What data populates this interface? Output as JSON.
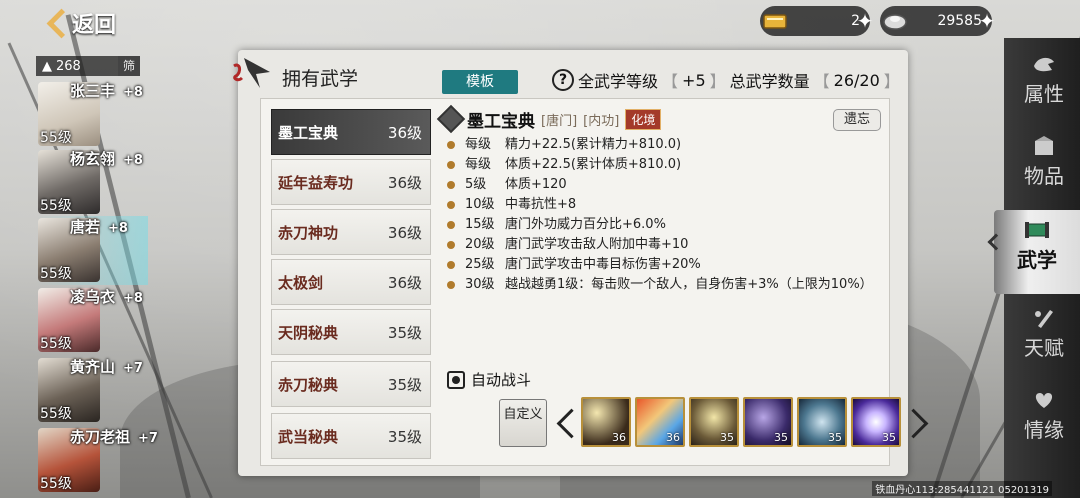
{
  "header": {
    "back_label": "返回",
    "currency_gold": "2",
    "currency_silver": "29585"
  },
  "hero_filter": {
    "power": "268",
    "filter_label": "筛"
  },
  "heroes": [
    {
      "name": "张三丰",
      "bonus": "+8",
      "level": "55级"
    },
    {
      "name": "杨玄翎",
      "bonus": "+8",
      "level": "55级"
    },
    {
      "name": "唐若",
      "bonus": "+8",
      "level": "55级"
    },
    {
      "name": "凌乌衣",
      "bonus": "+8",
      "level": "55级"
    },
    {
      "name": "黄齐山",
      "bonus": "+7",
      "level": "55级"
    },
    {
      "name": "赤刀老祖",
      "bonus": "+7",
      "level": "55级"
    }
  ],
  "panel": {
    "title": "拥有武学",
    "template_label": "模板",
    "total_level_label": "全武学等级",
    "total_level_value": "+5",
    "count_label": "总武学数量",
    "count_value": "26/20"
  },
  "skills": [
    {
      "name": "墨工宝典",
      "level": "36级"
    },
    {
      "name": "延年益寿功",
      "level": "36级"
    },
    {
      "name": "赤刀神功",
      "level": "36级"
    },
    {
      "name": "太极剑",
      "level": "36级"
    },
    {
      "name": "天阴秘典",
      "level": "35级"
    },
    {
      "name": "赤刀秘典",
      "level": "35级"
    },
    {
      "name": "武当秘典",
      "level": "35级"
    }
  ],
  "detail": {
    "name": "墨工宝典",
    "tag_sect": "[唐门]",
    "tag_type": "[内功]",
    "badge": "化境",
    "forget_label": "遗忘",
    "bonuses": [
      {
        "lvl": "每级",
        "text": "精力+22.5(累计精力+810.0)"
      },
      {
        "lvl": "每级",
        "text": "体质+22.5(累计体质+810.0)"
      },
      {
        "lvl": "5级",
        "text": "体质+120"
      },
      {
        "lvl": "10级",
        "text": "中毒抗性+8"
      },
      {
        "lvl": "15级",
        "text": "唐门外功威力百分比+6.0%"
      },
      {
        "lvl": "20级",
        "text": "唐门武学攻击敌人附加中毒+10"
      },
      {
        "lvl": "25级",
        "text": "唐门武学攻击中毒目标伤害+20%"
      },
      {
        "lvl": "30级",
        "text": "越战越勇1级：每击败一个敌人，自身伤害+3%（上限为10%）"
      }
    ]
  },
  "auto_battle": {
    "title": "自动战斗",
    "custom_label": "自定义",
    "slots": [
      {
        "level": "36",
        "icon": "sword-slash-icon"
      },
      {
        "level": "36",
        "icon": "fire-ice-icon"
      },
      {
        "level": "35",
        "icon": "meditation-icon"
      },
      {
        "level": "35",
        "icon": "shadow-strike-icon"
      },
      {
        "level": "35",
        "icon": "wind-strike-icon"
      },
      {
        "level": "35",
        "icon": "light-burst-icon"
      }
    ]
  },
  "right_tabs": [
    {
      "label": "属性",
      "icon": "bird-icon"
    },
    {
      "label": "物品",
      "icon": "box-icon"
    },
    {
      "label": "武学",
      "icon": "scroll-icon",
      "active": true
    },
    {
      "label": "天赋",
      "icon": "pen-icon"
    },
    {
      "label": "情缘",
      "icon": "heart-knot-icon"
    }
  ],
  "footer": {
    "id_text": "铁血丹心113:285441121 05201319"
  }
}
